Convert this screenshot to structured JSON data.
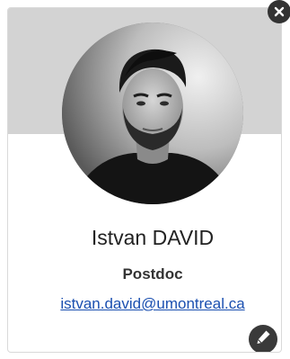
{
  "profile": {
    "name": "Istvan DAVID",
    "role": "Postdoc",
    "email": "istvan.david@umontreal.ca"
  },
  "icons": {
    "close": "close-icon",
    "edit": "pencil-icon",
    "avatar": "profile-photo"
  },
  "colors": {
    "banner": "#d3d3d3",
    "link": "#1a4fb0",
    "button": "#333333"
  }
}
